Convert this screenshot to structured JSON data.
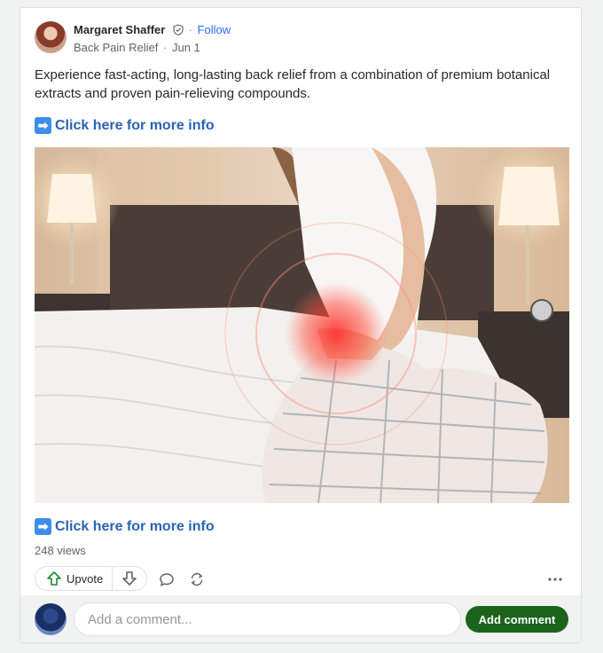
{
  "post": {
    "author_name": "Margaret Shaffer",
    "follow_label": "Follow",
    "separator": "·",
    "space": "Back Pain Relief",
    "date": "Jun 1",
    "body": "Experience fast-acting, long-lasting back relief from a combination of premium botanical extracts and proven pain-relieving compounds.",
    "link_top_arrow": "➡",
    "link_top_label": "Click here for more info",
    "link_bottom_arrow": "➡",
    "link_bottom_label": "Click here for more info",
    "views": "248 views"
  },
  "actions": {
    "upvote_label": "Upvote",
    "upvote_icon": "arrow-up-icon",
    "downvote_icon": "arrow-down-icon",
    "comment_icon": "speech-bubble-icon",
    "share_icon": "reshare-icon",
    "more_icon": "more-dots-icon"
  },
  "comment": {
    "placeholder": "Add a comment...",
    "button_label": "Add comment"
  },
  "colors": {
    "link": "#2a63b4",
    "follow": "#2e69ff",
    "add_comment_bg": "#1c641c"
  }
}
